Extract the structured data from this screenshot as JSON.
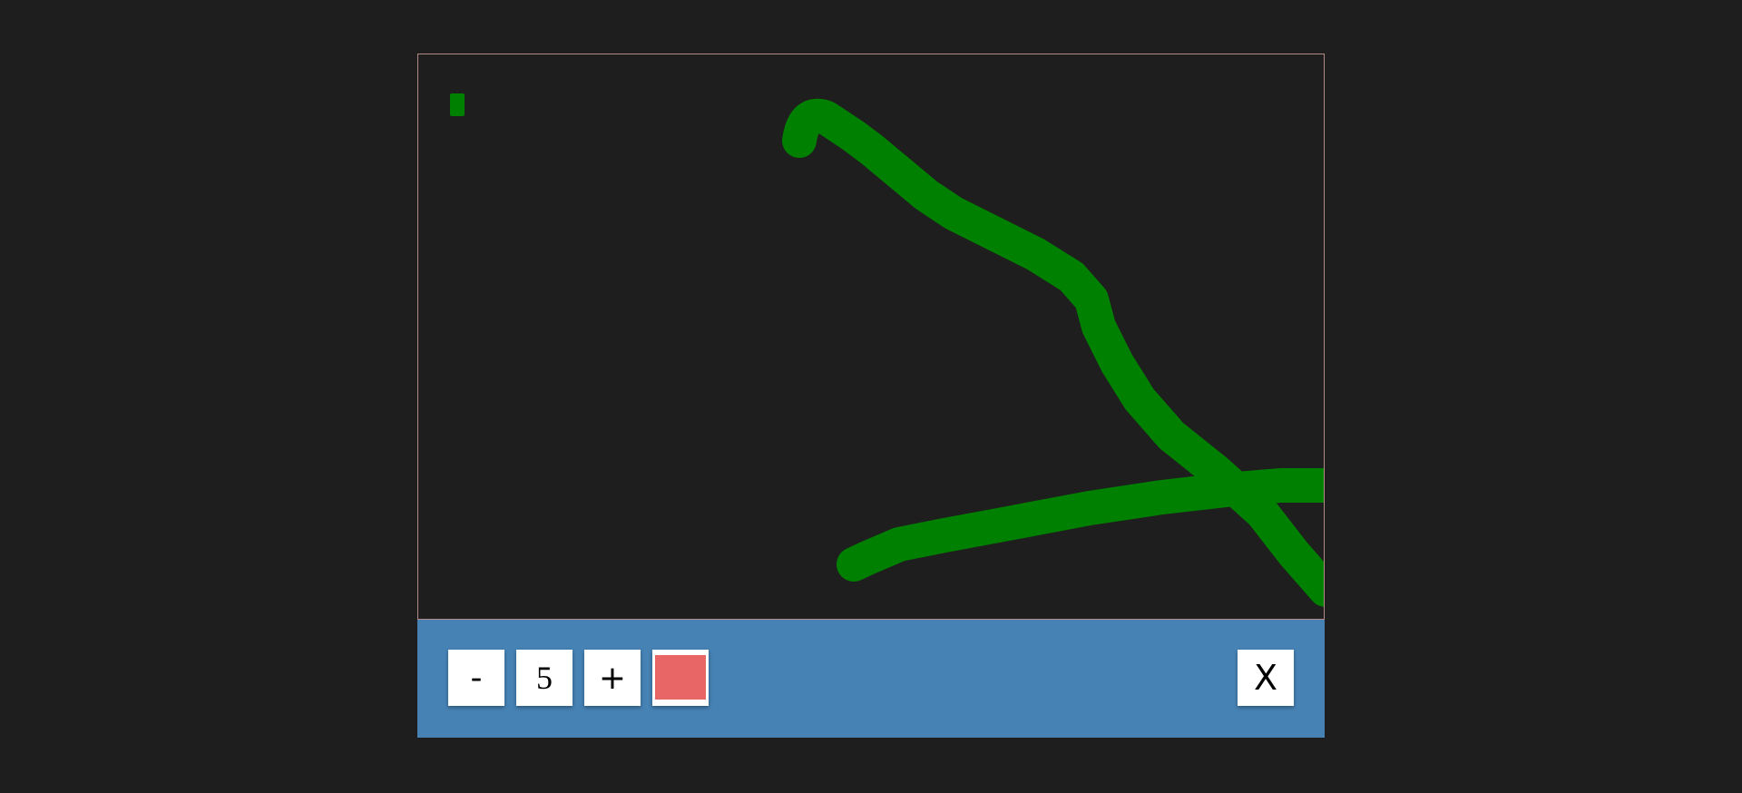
{
  "canvas": {
    "background_color": "#1e1e1e",
    "border_color": "#b38b86",
    "stroke_color": "#008000"
  },
  "toolbar": {
    "background_color": "#4682b4",
    "decrease_label": "-",
    "size_value": "5",
    "increase_label": "+",
    "selected_color": "#e86666",
    "close_label": "X"
  }
}
